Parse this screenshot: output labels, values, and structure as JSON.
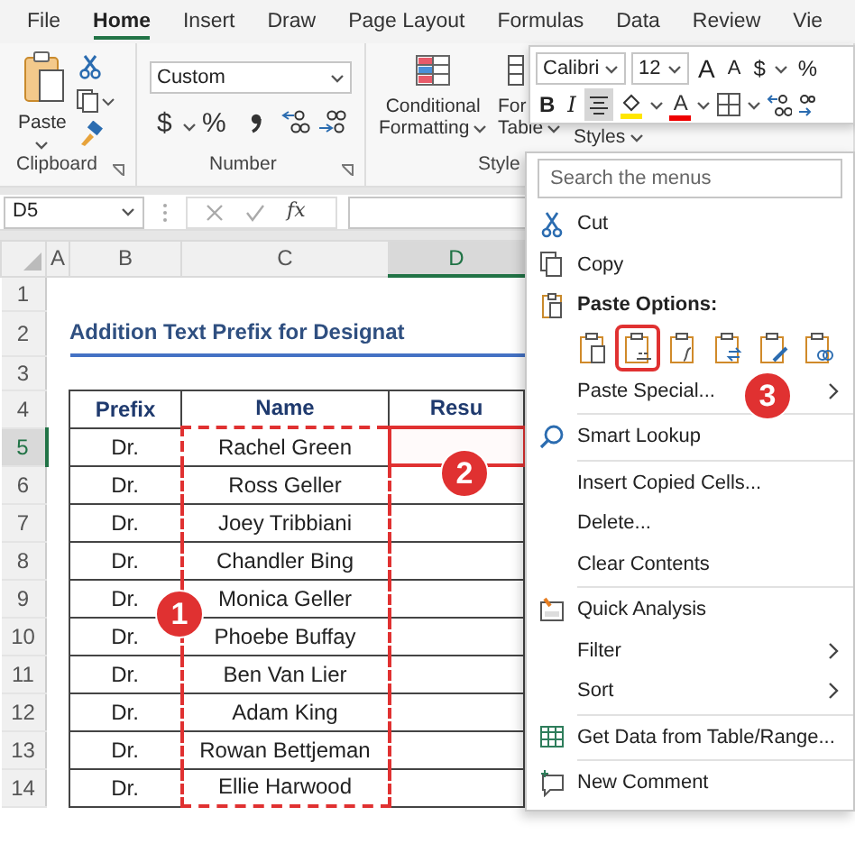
{
  "ribbon_tabs": [
    {
      "label": "File",
      "selected": false
    },
    {
      "label": "Home",
      "selected": true
    },
    {
      "label": "Insert",
      "selected": false
    },
    {
      "label": "Draw",
      "selected": false
    },
    {
      "label": "Page Layout",
      "selected": false
    },
    {
      "label": "Formulas",
      "selected": false
    },
    {
      "label": "Data",
      "selected": false
    },
    {
      "label": "Review",
      "selected": false
    },
    {
      "label": "Vie",
      "selected": false
    }
  ],
  "clipboard": {
    "paste": "Paste",
    "label": "Clipboard"
  },
  "number": {
    "format": "Custom",
    "currency": "$",
    "percent": "%",
    "label": "Number"
  },
  "styles": {
    "conditional": "Conditional",
    "formatting": "Formatting",
    "format_table": "For",
    "table": "Table",
    "cell_styles": "Styles",
    "label": "Style"
  },
  "mini_toolbar": {
    "font": "Calibri",
    "size": "12",
    "grow": "A",
    "shrink": "A",
    "currency": "$",
    "percent": "%",
    "bold": "B",
    "italic": "I",
    "center_selected": true,
    "font_color": "A"
  },
  "formula_bar": {
    "name_box": "D5",
    "function": "fx"
  },
  "sheet": {
    "columns": [
      {
        "label": "A",
        "selected": false
      },
      {
        "label": "B",
        "selected": false
      },
      {
        "label": "C",
        "selected": false
      },
      {
        "label": "D",
        "selected": true
      }
    ],
    "row_headers": [
      {
        "label": "1",
        "selected": false
      },
      {
        "label": "2",
        "selected": false
      },
      {
        "label": "3",
        "selected": false
      },
      {
        "label": "4",
        "selected": false
      },
      {
        "label": "5",
        "selected": true
      },
      {
        "label": "6",
        "selected": false
      },
      {
        "label": "7",
        "selected": false
      },
      {
        "label": "8",
        "selected": false
      },
      {
        "label": "9",
        "selected": false
      },
      {
        "label": "10",
        "selected": false
      },
      {
        "label": "11",
        "selected": false
      },
      {
        "label": "12",
        "selected": false
      },
      {
        "label": "13",
        "selected": false
      },
      {
        "label": "14",
        "selected": false
      }
    ],
    "title": "Addition Text Prefix for Designat",
    "headers": [
      "Prefix",
      "Name",
      "Resu"
    ],
    "rows": [
      {
        "prefix": "Dr.",
        "name": "Rachel Green",
        "copied": true,
        "selected": true
      },
      {
        "prefix": "Dr.",
        "name": "Ross Geller",
        "copied": true,
        "selected": false
      },
      {
        "prefix": "Dr.",
        "name": "Joey Tribbiani",
        "copied": true,
        "selected": false
      },
      {
        "prefix": "Dr.",
        "name": "Chandler Bing",
        "copied": true,
        "selected": false
      },
      {
        "prefix": "Dr.",
        "name": "Monica Geller",
        "copied": true,
        "selected": false
      },
      {
        "prefix": "Dr.",
        "name": "Phoebe Buffay",
        "copied": true,
        "selected": false
      },
      {
        "prefix": "Dr.",
        "name": "Ben Van Lier",
        "copied": true,
        "selected": false
      },
      {
        "prefix": "Dr.",
        "name": "Adam King",
        "copied": true,
        "selected": false
      },
      {
        "prefix": "Dr.",
        "name": "Rowan Bettjeman",
        "copied": true,
        "selected": false
      },
      {
        "prefix": "Dr.",
        "name": "Ellie Harwood",
        "copied": true,
        "selected": false
      }
    ]
  },
  "context_menu": {
    "search": {
      "placeholder": "Search the menus"
    },
    "items": [
      {
        "kind": "item",
        "label": "Cut"
      },
      {
        "kind": "item",
        "label": "Copy"
      },
      {
        "kind": "header",
        "label": "Paste Options:"
      },
      {
        "kind": "paste",
        "options": [
          {
            "selected": false
          },
          {
            "selected": true
          },
          {
            "selected": false
          },
          {
            "selected": false
          },
          {
            "selected": false
          },
          {
            "selected": false
          }
        ]
      },
      {
        "kind": "item",
        "label": "Paste Special...",
        "submenu": true
      },
      {
        "kind": "separator"
      },
      {
        "kind": "item",
        "label": "Smart Lookup"
      },
      {
        "kind": "separator"
      },
      {
        "kind": "item",
        "label": "Insert Copied Cells..."
      },
      {
        "kind": "item",
        "label": "Delete..."
      },
      {
        "kind": "item",
        "label": "Clear Contents"
      },
      {
        "kind": "separator"
      },
      {
        "kind": "item",
        "label": "Quick Analysis"
      },
      {
        "kind": "item",
        "label": "Filter",
        "submenu": true
      },
      {
        "kind": "item",
        "label": "Sort",
        "submenu": true
      },
      {
        "kind": "separator"
      },
      {
        "kind": "item",
        "label": "Get Data from Table/Range..."
      },
      {
        "kind": "separator"
      },
      {
        "kind": "item",
        "label": "New Comment"
      }
    ]
  },
  "annotations": [
    {
      "label": "1"
    },
    {
      "label": "2"
    },
    {
      "label": "3"
    }
  ]
}
